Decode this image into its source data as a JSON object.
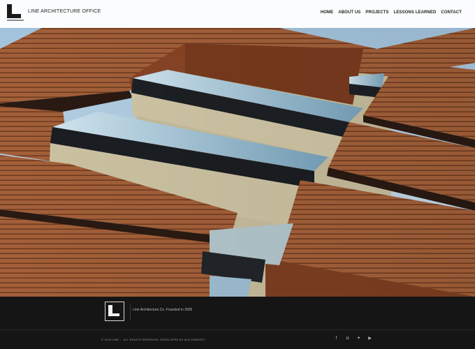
{
  "header": {
    "brand": "LINE ARCHITECTURE OFFICE",
    "nav": [
      "HOME",
      "ABOUT US",
      "PROJECTS",
      "LESSONS LEARNED",
      "CONTACT"
    ]
  },
  "footer": {
    "tagline": "Line Architecture Co. Founded in 2005",
    "copyright": "© 2015 LINE - . ALL RIGHTS RESERVED. DEVELOPED BY ALA SHARIATY",
    "socials": [
      "facebook-icon",
      "instagram-icon",
      "twitter-icon",
      "video-icon"
    ]
  },
  "colors": {
    "wood": "#9b5a36",
    "wood_dark": "#5b2e18",
    "sky": "#b8d2e6",
    "glass": "#8fb2c6",
    "footer_bg": "#151515"
  }
}
